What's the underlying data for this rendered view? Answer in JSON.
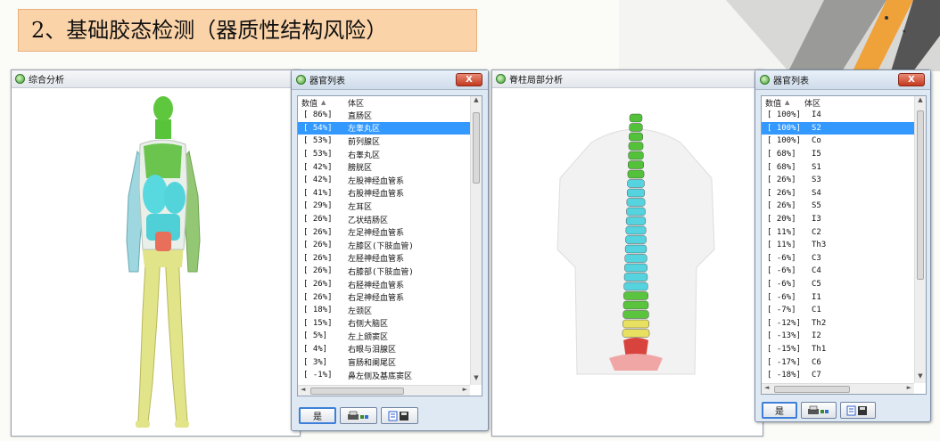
{
  "slide_title": "2、基础胶态检测（器质性结构风险）",
  "windows": {
    "comprehensive_title": "综合分析",
    "spine_title": "脊柱局部分析"
  },
  "organ_dialog_1": {
    "title": "器官列表",
    "close": "X",
    "header_value": "数值",
    "header_sort": "▲",
    "header_region": "体区",
    "rows": [
      {
        "v": "[  86%]",
        "n": "直肠区"
      },
      {
        "v": "[  54%]",
        "n": "左睾丸区"
      },
      {
        "v": "[  53%]",
        "n": "前列腺区"
      },
      {
        "v": "[  53%]",
        "n": "右睾丸区"
      },
      {
        "v": "[  42%]",
        "n": "膀胱区"
      },
      {
        "v": "[  42%]",
        "n": "左股神经血管系"
      },
      {
        "v": "[  41%]",
        "n": "右股神经血管系"
      },
      {
        "v": "[  29%]",
        "n": "左耳区"
      },
      {
        "v": "[  26%]",
        "n": "乙状结肠区"
      },
      {
        "v": "[  26%]",
        "n": "左足神经血管系"
      },
      {
        "v": "[  26%]",
        "n": "左膝区(下肢血管)"
      },
      {
        "v": "[  26%]",
        "n": "左胫神经血管系"
      },
      {
        "v": "[  26%]",
        "n": "右膝部(下肢血管)"
      },
      {
        "v": "[  26%]",
        "n": "右胫神经血管系"
      },
      {
        "v": "[  26%]",
        "n": "右足神经血管系"
      },
      {
        "v": "[  18%]",
        "n": "左颈区"
      },
      {
        "v": "[  15%]",
        "n": "右侧大脑区"
      },
      {
        "v": "[   5%]",
        "n": "左上颌窦区"
      },
      {
        "v": "[   4%]",
        "n": "右眼与泪腺区"
      },
      {
        "v": "[   3%]",
        "n": "盲肠和阑尾区"
      },
      {
        "v": "[  -1%]",
        "n": "鼻左侧及基底窦区"
      }
    ],
    "selected_index": 1,
    "ok_label": "是"
  },
  "organ_dialog_2": {
    "title": "器官列表",
    "close": "X",
    "header_value": "数值",
    "header_sort": "▲",
    "header_region": "体区",
    "rows": [
      {
        "v": "[ 100%]",
        "n": "I4"
      },
      {
        "v": "[ 100%]",
        "n": "S2"
      },
      {
        "v": "[ 100%]",
        "n": "Co"
      },
      {
        "v": "[  68%]",
        "n": "I5"
      },
      {
        "v": "[  68%]",
        "n": "S1"
      },
      {
        "v": "[  26%]",
        "n": "S3"
      },
      {
        "v": "[  26%]",
        "n": "S4"
      },
      {
        "v": "[  26%]",
        "n": "S5"
      },
      {
        "v": "[  20%]",
        "n": "I3"
      },
      {
        "v": "[  11%]",
        "n": "C2"
      },
      {
        "v": "[  11%]",
        "n": "Th3"
      },
      {
        "v": "[  -6%]",
        "n": "C3"
      },
      {
        "v": "[  -6%]",
        "n": "C4"
      },
      {
        "v": "[  -6%]",
        "n": "C5"
      },
      {
        "v": "[  -6%]",
        "n": "I1"
      },
      {
        "v": "[  -7%]",
        "n": "C1"
      },
      {
        "v": "[ -12%]",
        "n": "Th2"
      },
      {
        "v": "[ -13%]",
        "n": "I2"
      },
      {
        "v": "[ -15%]",
        "n": "Th1"
      },
      {
        "v": "[ -17%]",
        "n": "C6"
      },
      {
        "v": "[ -18%]",
        "n": "C7"
      }
    ],
    "selected_index": 1,
    "ok_label": "是"
  },
  "scroll": {
    "up": "▲",
    "down": "▼",
    "left": "◄",
    "right": "►"
  },
  "icons": [
    "app-icon",
    "print-icon",
    "export-icon",
    "close-icon"
  ]
}
